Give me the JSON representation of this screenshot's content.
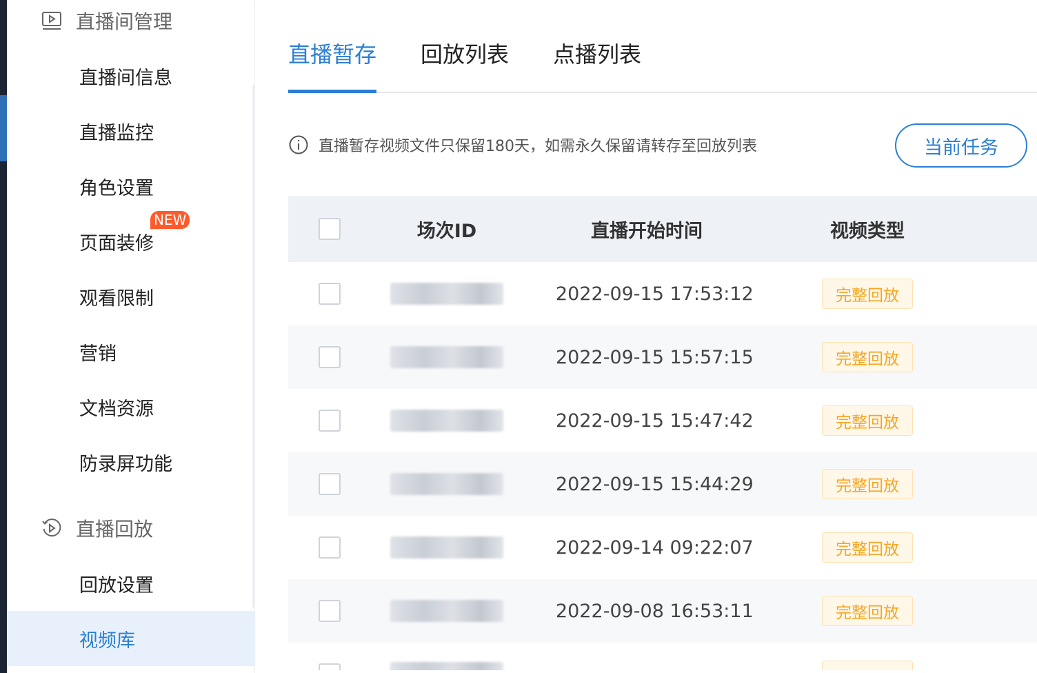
{
  "sidebar": {
    "group1": {
      "label": "直播间管理",
      "icon": "play-square-icon"
    },
    "items": [
      {
        "label": "直播间信息"
      },
      {
        "label": "直播监控"
      },
      {
        "label": "角色设置"
      },
      {
        "label": "页面装修",
        "badge": "NEW"
      },
      {
        "label": "观看限制"
      },
      {
        "label": "营销"
      },
      {
        "label": "文档资源"
      },
      {
        "label": "防录屏功能"
      }
    ],
    "group2": {
      "label": "直播回放",
      "icon": "replay-circle-icon"
    },
    "items2": [
      {
        "label": "回放设置"
      },
      {
        "label": "视频库",
        "active": true
      }
    ]
  },
  "tabs": [
    {
      "label": "直播暂存",
      "active": true
    },
    {
      "label": "回放列表"
    },
    {
      "label": "点播列表"
    }
  ],
  "notice": "直播暂存视频文件只保留180天，如需永久保留请转存至回放列表",
  "task_button": "当前任务",
  "table": {
    "columns": [
      "场次ID",
      "直播开始时间",
      "视频类型"
    ],
    "rows": [
      {
        "time": "2022-09-15 17:53:12",
        "type": "完整回放"
      },
      {
        "time": "2022-09-15 15:57:15",
        "type": "完整回放"
      },
      {
        "time": "2022-09-15 15:47:42",
        "type": "完整回放"
      },
      {
        "time": "2022-09-15 15:44:29",
        "type": "完整回放"
      },
      {
        "time": "2022-09-14 09:22:07",
        "type": "完整回放"
      },
      {
        "time": "2022-09-08 16:53:11",
        "type": "完整回放"
      }
    ]
  },
  "colors": {
    "accent": "#2b7fd4",
    "badge": "#ff5a2b",
    "tag_text": "#f5a623",
    "tag_bg": "#fff7e8"
  }
}
